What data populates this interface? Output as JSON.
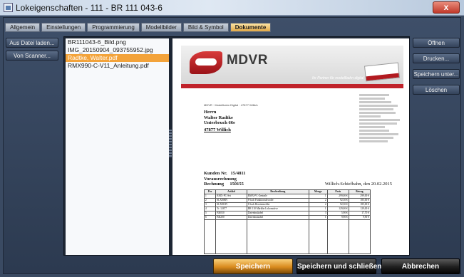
{
  "window": {
    "title": "Lokeigenschaften - 111 - BR 111 043-6",
    "close_label": "x"
  },
  "tabs": [
    {
      "label": "Allgemein",
      "active": false
    },
    {
      "label": "Einstellungen",
      "active": false
    },
    {
      "label": "Programmierung",
      "active": false
    },
    {
      "label": "Modellbilder",
      "active": false
    },
    {
      "label": "Bild & Symbol",
      "active": false
    },
    {
      "label": "Dokumente",
      "active": true
    }
  ],
  "left_buttons": {
    "load_file": "Aus Datei laden...",
    "scanner": "Von Scanner..."
  },
  "files": [
    {
      "name": "BR111043-6_Bild.png",
      "selected": false
    },
    {
      "name": "IMG_20150904_093755952.jpg",
      "selected": false
    },
    {
      "name": "Radtke, Walter.pdf",
      "selected": true
    },
    {
      "name": "RMX990-C-V11_Anleitung.pdf",
      "selected": false
    }
  ],
  "right_buttons": {
    "open": "Öffnen",
    "print": "Drucken...",
    "save_as": "Speichern unter...",
    "delete": "Löschen"
  },
  "document": {
    "logo": "MDVR",
    "slogan": "Ihr Partner für modellbahn digital",
    "sender_line": "MDVR · Modellbahn Digital · 47877 Willich",
    "recipient": {
      "salutation": "Herrn",
      "name": "Walter Radtke",
      "street": "Unterbruch 66e",
      "city": "47877 Willich"
    },
    "customer_label": "Kunden Nr.",
    "customer_no": "15/4811",
    "preinvoice": "Vorausrechnung",
    "invoice_label": "Rechnung",
    "invoice_no": "150155",
    "place_date": "Willich-Schiefbahn, den 20.02.2015",
    "columns": [
      "Pos",
      "Artikel",
      "Beschreibung",
      "Menge",
      "Preis",
      "Betrag"
    ],
    "rows": [
      [
        "1",
        "RMX-PC-Set",
        "RMX-PC-Zentrale",
        "1",
        "299,00 €",
        "299,00 €"
      ],
      [
        "2",
        "SLX808N",
        "8-fach Funktionsdecoder",
        "2",
        "92,50 €",
        "185,00 €"
      ],
      [
        "3",
        "SLX810N",
        "8-fach Besetztmelder",
        "2",
        "92,50 €",
        "185,00 €"
      ],
      [
        "4",
        "Tr. 12677",
        "BR 110 Märklin Lokomotive",
        "1",
        "129,00 €",
        "129,00 €"
      ],
      [
        "5",
        "BK030",
        "Datenbuskabel",
        "3",
        "5,90 €",
        "17,70 €"
      ],
      [
        "6",
        "BK200",
        "Datenbuskabel",
        "1",
        "9,90 €",
        "9,90 €"
      ]
    ]
  },
  "bottom_buttons": {
    "save": "Speichern",
    "save_close": "Speichern und schließen",
    "cancel": "Abbrechen"
  }
}
